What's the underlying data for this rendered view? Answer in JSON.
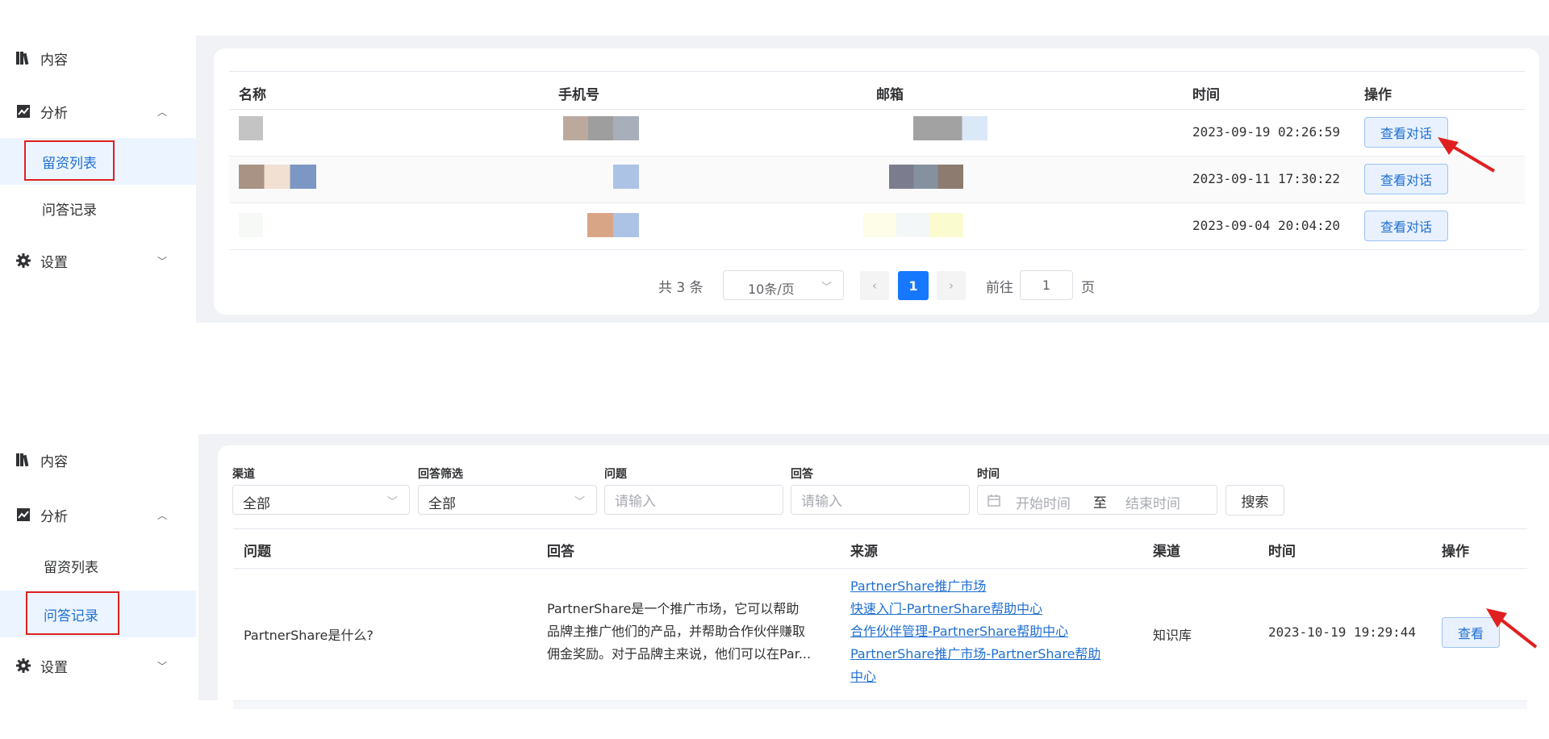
{
  "nav": {
    "content": "内容",
    "analysis": "分析",
    "leads": "留资列表",
    "qa_records": "问答记录",
    "settings": "设置"
  },
  "leads_table": {
    "headers": {
      "name": "名称",
      "phone": "手机号",
      "email": "邮箱",
      "time": "时间",
      "action": "操作"
    },
    "rows": [
      {
        "time": "2023-09-19 02:26:59",
        "action": "查看对话"
      },
      {
        "time": "2023-09-11 17:30:22",
        "action": "查看对话"
      },
      {
        "time": "2023-09-04 20:04:20",
        "action": "查看对话"
      }
    ],
    "pagination": {
      "total": "共 3 条",
      "page_size": "10条/页",
      "current_page": "1",
      "goto_label": "前往",
      "goto_value": "1",
      "page_suffix": "页"
    }
  },
  "qa_filters": {
    "channel_label": "渠道",
    "channel_value": "全部",
    "answer_filter_label": "回答筛选",
    "answer_filter_value": "全部",
    "question_label": "问题",
    "question_placeholder": "请输入",
    "answer_label": "回答",
    "answer_placeholder": "请输入",
    "time_label": "时间",
    "start_placeholder": "开始时间",
    "range_separator": "至",
    "end_placeholder": "结束时间",
    "search_button": "搜索"
  },
  "qa_table": {
    "headers": {
      "question": "问题",
      "answer": "回答",
      "source": "来源",
      "channel": "渠道",
      "time": "时间",
      "action": "操作"
    },
    "row": {
      "question": "PartnerShare是什么?",
      "answer_lines": [
        "PartnerShare是一个推广市场，它可以帮助",
        "品牌主推广他们的产品，并帮助合作伙伴赚取",
        "佣金奖励。对于品牌主来说，他们可以在Par..."
      ],
      "sources": [
        "PartnerShare推广市场",
        "快速入门-PartnerShare帮助中心",
        "合作伙伴管理-PartnerShare帮助中心",
        "PartnerShare推广市场-PartnerShare帮助",
        "中心"
      ],
      "channel": "知识库",
      "time": "2023-10-19 19:29:44",
      "action": "查看"
    }
  },
  "colors": {
    "primary": "#1677ff",
    "link": "#1f6fd1",
    "highlight_box": "#e02020",
    "content_bg": "#f0f2f5"
  }
}
